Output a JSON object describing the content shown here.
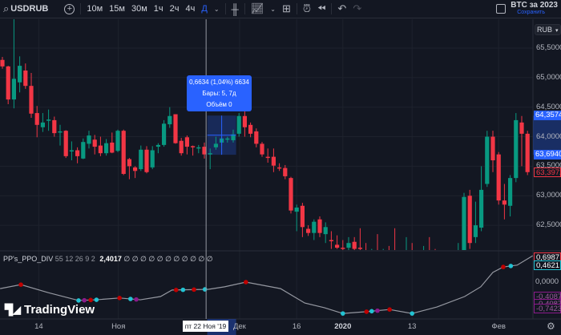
{
  "toolbar": {
    "symbol": "USDRUB",
    "intervals": [
      "10м",
      "15м",
      "30м",
      "1ч",
      "2ч",
      "4ч",
      "Д"
    ],
    "active_interval": "Д",
    "layout_name": "BTC за 2023",
    "save_label": "Сохранить"
  },
  "colors": {
    "bg": "#131722",
    "up": "#089981",
    "down": "#f23645",
    "accent": "#2962ff",
    "ppo_line": "#9598a1",
    "marker_red": "#c00000",
    "marker_cyan": "#22c3d3",
    "marker_purple": "#8b1a8b"
  },
  "currency": "RUB",
  "price_axis": {
    "labels": [
      "65,5000",
      "65,0000",
      "64,5000",
      "64,0000",
      "63,5000",
      "63,0000",
      "62,5000"
    ],
    "values": [
      65.5,
      65.0,
      64.5,
      64.0,
      63.5,
      63.0,
      62.5
    ],
    "badges": [
      {
        "text": "64,3574",
        "value": 64.3574,
        "style": "blue"
      },
      {
        "text": "63,6940",
        "value": 63.694,
        "style": "blue"
      },
      {
        "text": "63,3972",
        "value": 63.3972,
        "style": "red"
      }
    ]
  },
  "measure": {
    "line1": "0,6634 (1,04%) 6634",
    "line2": "Бары: 5, 7д",
    "line3": "Объём 0",
    "from_price": 63.694,
    "to_price": 64.3574,
    "from_bar": 35.5,
    "to_bar": 40.5
  },
  "candles": [
    [
      65.3,
      65.35,
      65.15,
      65.19
    ],
    [
      65.19,
      65.2,
      64.55,
      64.63
    ],
    [
      64.63,
      66.0,
      64.48,
      64.98
    ],
    [
      64.92,
      65.36,
      64.75,
      65.2
    ],
    [
      65.12,
      65.24,
      64.81,
      64.86
    ],
    [
      64.86,
      65.08,
      64.32,
      64.39
    ],
    [
      64.4,
      64.52,
      63.99,
      64.2
    ],
    [
      64.16,
      64.4,
      64.08,
      64.24
    ],
    [
      64.27,
      64.46,
      64.1,
      64.29
    ],
    [
      64.28,
      64.34,
      64.0,
      64.06
    ],
    [
      64.08,
      64.2,
      63.85,
      64.09
    ],
    [
      64.1,
      64.11,
      63.64,
      63.67
    ],
    [
      63.75,
      63.92,
      63.6,
      63.77
    ],
    [
      63.77,
      63.82,
      63.55,
      63.67
    ],
    [
      63.63,
      63.97,
      63.62,
      63.91
    ],
    [
      63.88,
      64.1,
      63.8,
      64.02
    ],
    [
      63.95,
      64.03,
      63.7,
      63.83
    ],
    [
      63.85,
      64.0,
      63.67,
      63.72
    ],
    [
      63.72,
      63.96,
      63.68,
      63.89
    ],
    [
      63.9,
      64.07,
      63.72,
      63.73
    ],
    [
      63.76,
      64.12,
      63.74,
      64.1
    ],
    [
      64.1,
      64.12,
      63.35,
      63.37
    ],
    [
      63.62,
      63.64,
      63.28,
      63.5
    ],
    [
      63.48,
      63.5,
      63.3,
      63.42
    ],
    [
      63.45,
      63.85,
      63.42,
      63.78
    ],
    [
      63.78,
      63.84,
      63.38,
      63.4
    ],
    [
      63.48,
      63.84,
      63.45,
      63.77
    ],
    [
      63.83,
      63.89,
      63.72,
      63.86
    ],
    [
      63.86,
      64.28,
      63.83,
      64.22
    ],
    [
      64.21,
      64.5,
      64.15,
      64.35
    ],
    [
      64.38,
      64.38,
      63.88,
      63.89
    ],
    [
      63.93,
      63.98,
      63.68,
      63.72
    ],
    [
      63.99,
      64.02,
      63.7,
      63.83
    ],
    [
      63.84,
      63.85,
      63.68,
      63.82
    ],
    [
      63.8,
      63.86,
      63.72,
      63.82
    ],
    [
      63.83,
      63.9,
      63.63,
      63.7
    ],
    [
      63.71,
      63.8,
      63.45,
      63.72
    ],
    [
      63.82,
      64.0,
      63.78,
      63.88
    ],
    [
      63.9,
      64.0,
      63.85,
      63.97
    ],
    [
      63.95,
      64.0,
      63.9,
      63.97
    ],
    [
      63.94,
      64.12,
      63.9,
      64.04
    ],
    [
      64.05,
      64.4,
      64.0,
      64.35
    ],
    [
      64.35,
      64.44,
      64.0,
      64.16
    ],
    [
      64.2,
      64.24,
      63.99,
      64.05
    ],
    [
      64.09,
      64.14,
      63.82,
      63.88
    ],
    [
      63.88,
      63.91,
      63.66,
      63.7
    ],
    [
      63.66,
      63.8,
      63.56,
      63.64
    ],
    [
      63.66,
      63.8,
      63.4,
      63.51
    ],
    [
      63.48,
      63.55,
      63.42,
      63.46
    ],
    [
      63.47,
      63.52,
      63.28,
      63.33
    ],
    [
      63.3,
      63.32,
      62.7,
      62.75
    ],
    [
      62.73,
      62.85,
      62.4,
      62.8
    ],
    [
      62.83,
      62.88,
      62.3,
      62.47
    ],
    [
      62.44,
      62.5,
      62.32,
      62.37
    ],
    [
      62.37,
      62.6,
      62.25,
      62.56
    ],
    [
      62.6,
      62.65,
      62.3,
      62.37
    ],
    [
      62.35,
      62.55,
      62.2,
      62.47
    ],
    [
      62.25,
      62.4,
      62.1,
      62.23
    ],
    [
      62.17,
      62.33,
      62.1,
      62.12
    ],
    [
      62.12,
      62.25,
      62.05,
      62.1
    ],
    [
      62.12,
      62.3,
      62.05,
      62.2
    ],
    [
      62.22,
      62.3,
      62.05,
      62.1
    ],
    [
      62.12,
      62.45,
      62.0,
      62.1
    ],
    [
      62.05,
      62.2,
      61.8,
      61.9
    ],
    [
      61.9,
      62.1,
      61.7,
      61.95
    ],
    [
      61.95,
      62.35,
      61.8,
      61.85
    ],
    [
      61.85,
      62.1,
      61.7,
      62.0
    ],
    [
      62.0,
      62.15,
      61.8,
      61.9
    ],
    [
      61.9,
      62.45,
      61.75,
      61.8
    ],
    [
      61.8,
      62.0,
      61.6,
      61.9
    ],
    [
      61.9,
      62.3,
      61.8,
      62.0
    ],
    [
      62.0,
      62.2,
      61.85,
      61.95
    ],
    [
      61.95,
      62.05,
      61.7,
      61.85
    ],
    [
      61.85,
      62.15,
      61.75,
      62.0
    ],
    [
      62.0,
      62.3,
      61.9,
      61.95
    ],
    [
      61.95,
      62.1,
      61.8,
      61.85
    ],
    [
      61.85,
      62.0,
      61.6,
      61.75
    ],
    [
      61.75,
      61.95,
      61.6,
      61.9
    ],
    [
      61.9,
      62.05,
      61.7,
      61.8
    ],
    [
      61.8,
      62.2,
      61.7,
      62.0
    ],
    [
      61.9,
      63.05,
      61.8,
      62.98
    ],
    [
      63.0,
      63.1,
      62.1,
      62.2
    ],
    [
      62.3,
      62.9,
      62.2,
      62.5
    ],
    [
      62.46,
      63.5,
      62.4,
      63.1
    ],
    [
      63.2,
      64.1,
      63.15,
      64.0
    ],
    [
      64.0,
      64.1,
      63.4,
      63.6
    ],
    [
      63.7,
      63.74,
      62.85,
      62.92
    ],
    [
      62.92,
      63.2,
      62.6,
      62.85
    ],
    [
      62.83,
      63.35,
      62.65,
      63.3
    ],
    [
      63.3,
      64.4,
      63.23,
      64.28
    ],
    [
      64.24,
      64.35,
      63.5,
      64.05
    ],
    [
      64.05,
      64.1,
      63.35,
      63.4
    ]
  ],
  "indicator": {
    "name": "PP's_PPO_DIV",
    "params": "55 12 26 9 2",
    "value": "2,4017",
    "empty_values": "∅ ∅ ∅ ∅ ∅ ∅ ∅ ∅ ∅ ∅ ∅",
    "line": [
      [
        -0.4,
        -0.18
      ],
      [
        3.2,
        -0.07
      ],
      [
        7.9,
        -0.29
      ],
      [
        13.2,
        -0.51
      ],
      [
        16.3,
        -0.49
      ],
      [
        20.3,
        -0.44
      ],
      [
        23.9,
        -0.49
      ],
      [
        27.4,
        -0.4
      ],
      [
        29.4,
        -0.22
      ],
      [
        35.7,
        -0.2
      ],
      [
        38.5,
        -0.13
      ],
      [
        42.2,
        0
      ],
      [
        48.2,
        -0.18
      ],
      [
        52.4,
        -0.58
      ],
      [
        55.8,
        -0.71
      ],
      [
        59.0,
        -0.87
      ],
      [
        63.1,
        -0.82
      ],
      [
        67.1,
        -0.76
      ],
      [
        71.0,
        -0.87
      ],
      [
        75.3,
        -0.69
      ],
      [
        80.1,
        -0.4
      ],
      [
        82.9,
        -0.13
      ],
      [
        85.0,
        0.27
      ],
      [
        86.8,
        0.42
      ],
      [
        89.2,
        0.47
      ],
      [
        91.9,
        0.73
      ]
    ],
    "markers": [
      [
        3.2,
        "red"
      ],
      [
        13.2,
        "cyan"
      ],
      [
        14.2,
        "purple"
      ],
      [
        15.3,
        "red"
      ],
      [
        16.3,
        "cyan"
      ],
      [
        20.3,
        "red"
      ],
      [
        22.2,
        "cyan"
      ],
      [
        23.2,
        "purple"
      ],
      [
        30.1,
        "red"
      ],
      [
        31.3,
        "cyan"
      ],
      [
        33.2,
        "red"
      ],
      [
        35.1,
        "cyan"
      ],
      [
        42.2,
        "red"
      ],
      [
        59.0,
        "cyan"
      ],
      [
        63.1,
        "red"
      ],
      [
        64.0,
        "cyan"
      ],
      [
        65.0,
        "purple"
      ],
      [
        67.1,
        "red"
      ],
      [
        71.0,
        "cyan"
      ],
      [
        86.8,
        "red"
      ],
      [
        88.1,
        "cyan"
      ]
    ],
    "axis_labels": [
      {
        "text": "0,6987",
        "value": 0.6987,
        "style": "white"
      },
      {
        "text": "0,4621",
        "value": 0.4621,
        "style": "teal"
      },
      {
        "text": "0,0000",
        "value": 0,
        "style": "plain"
      },
      {
        "text": "-0,4087",
        "value": -0.4087,
        "style": "purple"
      },
      {
        "text": "-0,4087",
        "value": -0.6,
        "style": "purple"
      },
      {
        "text": "-0,7423",
        "value": -0.7423,
        "style": "purple"
      }
    ]
  },
  "time_axis": {
    "labels": [
      {
        "text": "14",
        "bar": 6.3
      },
      {
        "text": "Ноя",
        "bar": 20.1
      },
      {
        "text": "Дек",
        "bar": 41.1
      },
      {
        "text": "16",
        "bar": 51
      },
      {
        "text": "2020",
        "bar": 59
      },
      {
        "text": "13",
        "bar": 71
      },
      {
        "text": "Фев",
        "bar": 86
      }
    ],
    "crosshair_label": "пт 22 Ноя '19",
    "crosshair_bar": 35.3
  },
  "brand": "TradingView"
}
